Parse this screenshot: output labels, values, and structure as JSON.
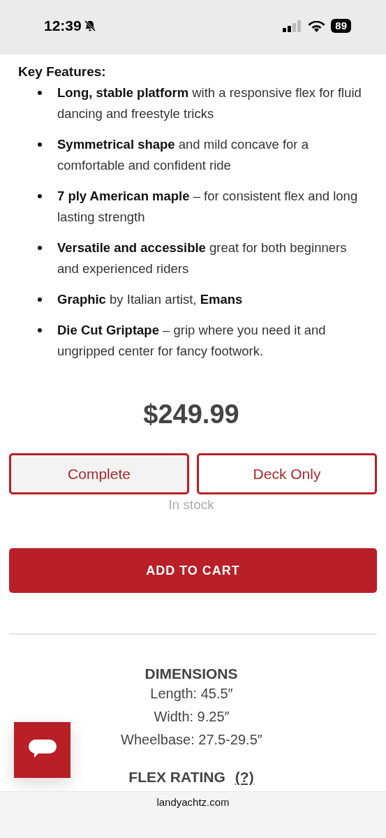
{
  "status_bar": {
    "time": "12:39",
    "silent": true,
    "battery": "89"
  },
  "features": {
    "heading": "Key Features:",
    "items": [
      "**Long, stable platform** with a responsive flex for fluid dancing and freestyle tricks",
      "**Symmetrical shape** and mild concave for a comfortable and confident ride",
      "**7 ply American maple** – for consistent flex and long lasting strength",
      "**Versatile and accessible** great for both beginners and experienced riders",
      "**Graphic** by Italian artist, **Emans**",
      "**Die Cut Griptape** – grip where you need it and ungripped center for fancy footwork."
    ]
  },
  "price": "$249.99",
  "options": [
    {
      "label": "Complete",
      "selected": true
    },
    {
      "label": "Deck Only",
      "selected": false
    }
  ],
  "stock": "In stock",
  "add_to_cart": "ADD TO CART",
  "dimensions": {
    "heading": "DIMENSIONS",
    "lines": [
      "Length: 45.5″",
      "Width: 9.25″",
      "Wheelbase: 27.5-29.5″"
    ]
  },
  "flex_rating": {
    "heading": "FLEX RATING",
    "help": "(?)"
  },
  "url_bar": {
    "domain": "landyachtz.com"
  }
}
